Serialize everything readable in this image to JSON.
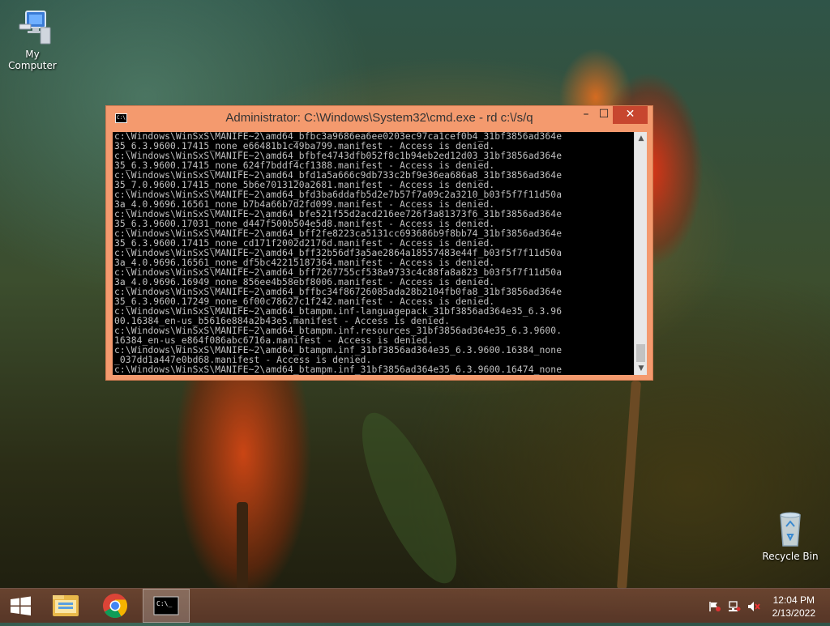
{
  "desktop": {
    "icons": [
      {
        "label": "My Computer",
        "icon": "computer-icon"
      },
      {
        "label": "Recycle Bin",
        "icon": "recycle-bin-icon"
      }
    ]
  },
  "window": {
    "title": "Administrator: C:\\Windows\\System32\\cmd.exe - rd  c:\\/s/q",
    "app_icon": "cmd-icon",
    "app_icon_text": "C:\\",
    "controls": {
      "minimize": "–",
      "maximize": "☐",
      "close": "✕"
    },
    "console_lines": [
      "c:\\Windows\\WinSxS\\MANIFE~2\\amd64_bfbc3a9686ea6ee0203ec97ca1cef0b4_31bf3856ad364e",
      "35_6.3.9600.17415_none_e66481b1c49ba799.manifest - Access is denied.",
      "c:\\Windows\\WinSxS\\MANIFE~2\\amd64_bfbfe4743dfb052f8c1b94eb2ed12d03_31bf3856ad364e",
      "35_6.3.9600.17415_none_624f7bddf4cf1388.manifest - Access is denied.",
      "c:\\Windows\\WinSxS\\MANIFE~2\\amd64_bfd1a5a666c9db733c2bf9e36ea686a8_31bf3856ad364e",
      "35_7.0.9600.17415_none_5b6e7013120a2681.manifest - Access is denied.",
      "c:\\Windows\\WinSxS\\MANIFE~2\\amd64_bfd3ba6ddafb5d2e7b57f7a09c2a3210_b03f5f7f11d50a",
      "3a_4.0.9696.16561_none_b7b4a66b7d2fd099.manifest - Access is denied.",
      "c:\\Windows\\WinSxS\\MANIFE~2\\amd64_bfe521f55d2acd216ee726f3a81373f6_31bf3856ad364e",
      "35_6.3.9600.17031_none_d447f500b504e5d8.manifest - Access is denied.",
      "c:\\Windows\\WinSxS\\MANIFE~2\\amd64_bff2fe8223ca5131cc693686b9f8bb74_31bf3856ad364e",
      "35_6.3.9600.17415_none_cd171f2002d2176d.manifest - Access is denied.",
      "c:\\Windows\\WinSxS\\MANIFE~2\\amd64_bff32b56df3a5ae2864a18557483e44f_b03f5f7f11d50a",
      "3a_4.0.9696.16561_none_df5bc42215187364.manifest - Access is denied.",
      "c:\\Windows\\WinSxS\\MANIFE~2\\amd64_bff7267755cf538a9733c4c88fa8a823_b03f5f7f11d50a",
      "3a_4.0.9696.16949_none_856ee4b58ebf8006.manifest - Access is denied.",
      "c:\\Windows\\WinSxS\\MANIFE~2\\amd64_bffbc34f86726085ada28b2104fb0fa8_31bf3856ad364e",
      "35_6.3.9600.17249_none_6f00c78627c1f242.manifest - Access is denied.",
      "c:\\Windows\\WinSxS\\MANIFE~2\\amd64_btampm.inf-languagepack_31bf3856ad364e35_6.3.96",
      "00.16384_en-us_b5616e884a2b43e5.manifest - Access is denied.",
      "c:\\Windows\\WinSxS\\MANIFE~2\\amd64_btampm.inf.resources_31bf3856ad364e35_6.3.9600.",
      "16384_en-us_e864f086abc6716a.manifest - Access is denied.",
      "c:\\Windows\\WinSxS\\MANIFE~2\\amd64_btampm.inf_31bf3856ad364e35_6.3.9600.16384_none",
      "_037dd1a447e0bd68.manifest - Access is denied.",
      "c:\\Windows\\WinSxS\\MANIFE~2\\amd64_btampm.inf_31bf3856ad364e35_6.3.9600.16474_none"
    ]
  },
  "taskbar": {
    "items": [
      {
        "name": "start-button",
        "icon": "windows-logo-icon"
      },
      {
        "name": "file-explorer",
        "icon": "folder-icon"
      },
      {
        "name": "chrome",
        "icon": "chrome-icon"
      },
      {
        "name": "command-prompt",
        "icon": "cmd-icon",
        "active": true
      }
    ],
    "tray": [
      "action-center-flag-icon",
      "network-icon",
      "volume-muted-icon"
    ],
    "time": "12:04 PM",
    "date": "2/13/2022"
  }
}
